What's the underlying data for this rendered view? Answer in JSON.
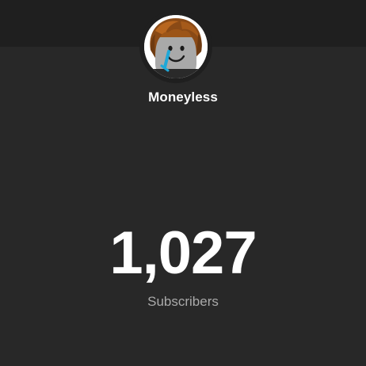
{
  "channel": {
    "name": "Moneyless",
    "avatar_icon": "roblox-bacon-hair-avatar"
  },
  "stats": {
    "subscriber_count": "1,027",
    "subscriber_label": "Subscribers"
  },
  "colors": {
    "background": "#282828",
    "header_band": "#1f1f1f",
    "primary_text": "#ffffff",
    "secondary_text": "#aaaaaa"
  }
}
